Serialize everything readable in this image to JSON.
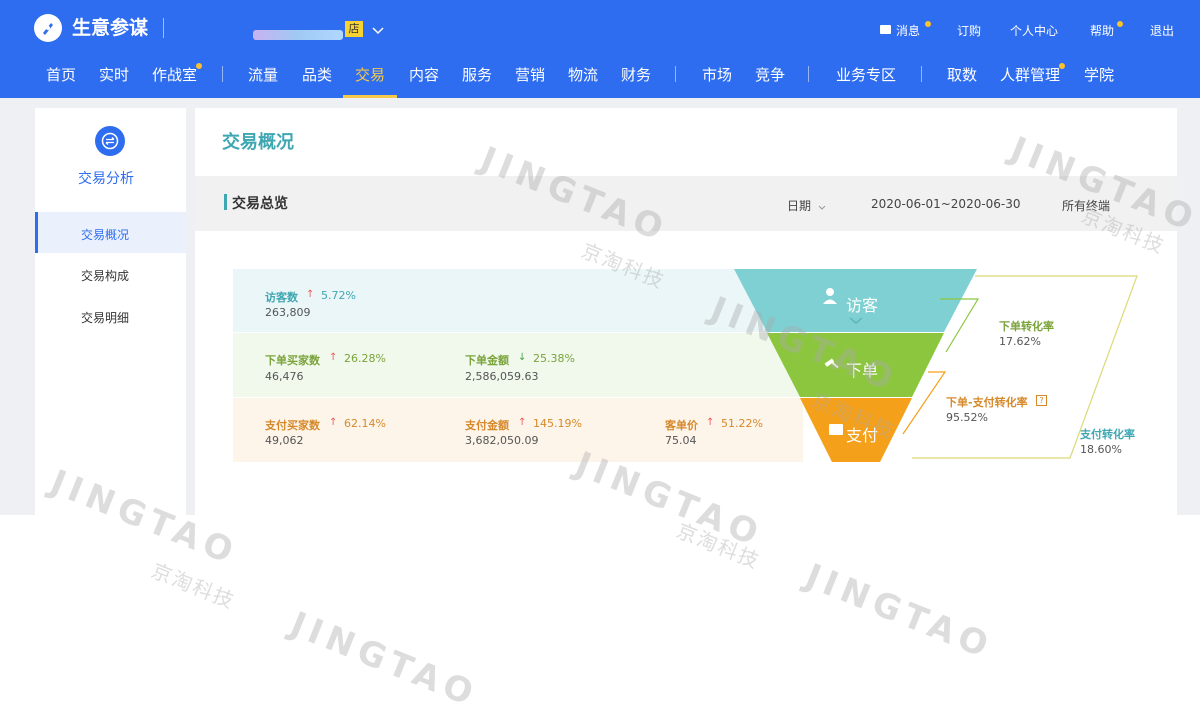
{
  "header": {
    "app_title": "生意参谋",
    "shop_badge": "店",
    "top_links": {
      "messages": "消息",
      "subscribe": "订购",
      "personal_center": "个人中心",
      "help": "帮助",
      "logout": "退出"
    },
    "nav": [
      "首页",
      "实时",
      "作战室",
      "流量",
      "品类",
      "交易",
      "内容",
      "服务",
      "营销",
      "物流",
      "财务",
      "市场",
      "竞争",
      "业务专区",
      "取数",
      "人群管理",
      "学院"
    ],
    "active_nav": "交易"
  },
  "sidebar": {
    "title": "交易分析",
    "items": [
      "交易概况",
      "交易构成",
      "交易明细"
    ]
  },
  "main": {
    "title": "交易概况",
    "section_title": "交易总览",
    "date_label": "日期",
    "date_range": "2020-06-01~2020-06-30",
    "terminal": "所有终端"
  },
  "metrics": {
    "visitors": {
      "label": "访客数",
      "pct": "5.72%",
      "value": "263,809",
      "trend": "up"
    },
    "order_buyers": {
      "label": "下单买家数",
      "pct": "26.28%",
      "value": "46,476",
      "trend": "up"
    },
    "order_amount": {
      "label": "下单金额",
      "pct": "25.38%",
      "value": "2,586,059.63",
      "trend": "down"
    },
    "pay_buyers": {
      "label": "支付买家数",
      "pct": "62.14%",
      "value": "49,062",
      "trend": "up"
    },
    "pay_amount": {
      "label": "支付金额",
      "pct": "145.19%",
      "value": "3,682,050.09",
      "trend": "up"
    },
    "unit_price": {
      "label": "客单价",
      "pct": "51.22%",
      "value": "75.04",
      "trend": "up"
    }
  },
  "funnel": {
    "stages": [
      "访客",
      "下单",
      "支付"
    ],
    "rates": {
      "order_rate": {
        "label": "下单转化率",
        "value": "17.62%"
      },
      "order_pay_rate": {
        "label": "下单-支付转化率",
        "value": "95.52%"
      },
      "pay_rate": {
        "label": "支付转化率",
        "value": "18.60%"
      }
    }
  },
  "watermark": {
    "brand": "JINGTAO",
    "brand_cn": "京淘科技"
  },
  "colors": {
    "header_blue": "#2f6df0",
    "accent_teal": "#3fa7b2",
    "funnel_teal": "#7fd0d2",
    "funnel_green": "#8cc63f",
    "funnel_orange": "#f5a01a",
    "up_red": "#ef5a5a",
    "down_green": "#4aa24a"
  }
}
